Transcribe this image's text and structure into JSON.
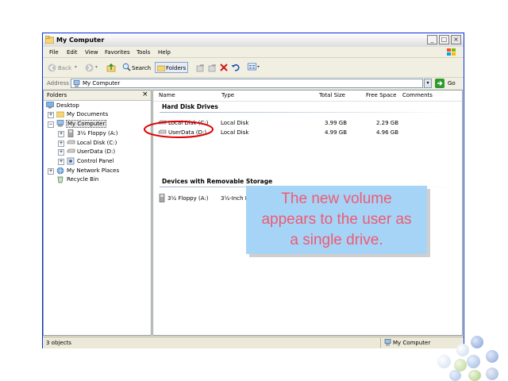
{
  "window": {
    "title": "My Computer",
    "controls": {
      "minimize": "_",
      "maximize": "□",
      "close": "×"
    }
  },
  "menu": [
    "File",
    "Edit",
    "View",
    "Favorites",
    "Tools",
    "Help"
  ],
  "toolbar": {
    "back_label": "Back",
    "search_label": "Search",
    "folders_label": "Folders"
  },
  "address": {
    "label": "Address",
    "value": "My Computer",
    "go_label": "Go"
  },
  "folders": {
    "title": "Folders",
    "tree": [
      {
        "label": "Desktop",
        "icon": "desktop-icon"
      },
      {
        "label": "My Documents",
        "icon": "folder-icon"
      },
      {
        "label": "My Computer",
        "icon": "computer-icon",
        "selected": true
      },
      {
        "label": "3½ Floppy (A:)",
        "icon": "floppy-icon"
      },
      {
        "label": "Local Disk (C:)",
        "icon": "drive-icon"
      },
      {
        "label": "UserData (D:)",
        "icon": "drive-icon"
      },
      {
        "label": "Control Panel",
        "icon": "control-panel-icon"
      },
      {
        "label": "My Network Places",
        "icon": "network-icon"
      },
      {
        "label": "Recycle Bin",
        "icon": "recycle-bin-icon"
      }
    ]
  },
  "columns": [
    "Name",
    "Type",
    "Total Size",
    "Free Space",
    "Comments"
  ],
  "groups": {
    "hard_disks": {
      "title": "Hard Disk Drives",
      "items": [
        {
          "name": "Local Disk (C:)",
          "type": "Local Disk",
          "total": "3.99 GB",
          "free": "2.29 GB"
        },
        {
          "name": "UserData (D:)",
          "type": "Local Disk",
          "total": "4.99 GB",
          "free": "4.96 GB"
        }
      ]
    },
    "removable": {
      "title": "Devices with Removable Storage",
      "items": [
        {
          "name": "3½ Floppy (A:)",
          "type": "3½-Inch Floppy Disk"
        }
      ]
    }
  },
  "status": {
    "count": "3 objects",
    "location": "My Computer"
  },
  "callout": {
    "line1": "The new volume",
    "line2": "appears to the user as",
    "line3": "a single drive."
  },
  "colors": {
    "title_bar": "#f4f4f4",
    "callout_bg": "#a6d4f7",
    "callout_text": "#f05a72",
    "highlight_ellipse": "#e00000",
    "bubbles": "#9fb8e0"
  }
}
